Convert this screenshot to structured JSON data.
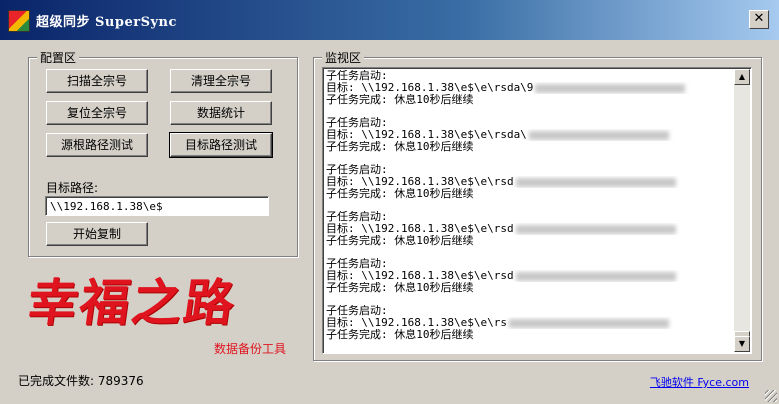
{
  "window": {
    "title": "超级同步 SuperSync",
    "close_glyph": "✕"
  },
  "config": {
    "group_label": "配置区",
    "buttons": {
      "scan": "扫描全宗号",
      "clean": "清理全宗号",
      "reset": "复位全宗号",
      "stats": "数据统计",
      "source_test": "源根路径测试",
      "target_test": "目标路径测试",
      "start_copy": "开始复制"
    },
    "target_path_label": "目标路径:",
    "target_path_value": "\\\\192.168.1.38\\e$"
  },
  "logo": {
    "text": "幸福之路",
    "subtitle": "数据备份工具"
  },
  "monitor": {
    "group_label": "监视区",
    "entries": [
      {
        "line1": "子任务启动:",
        "line2": "目标: \\\\192.168.1.38\\e$\\e\\rsda\\9",
        "line3": "子任务完成: 休息10秒后继续"
      },
      {
        "line1": "子任务启动:",
        "line2": "目标: \\\\192.168.1.38\\e$\\e\\rsda\\",
        "line3": "子任务完成: 休息10秒后继续"
      },
      {
        "line1": "子任务启动:",
        "line2": "目标: \\\\192.168.1.38\\e$\\e\\rsd",
        "line3": "子任务完成: 休息10秒后继续"
      },
      {
        "line1": "子任务启动:",
        "line2": "目标: \\\\192.168.1.38\\e$\\e\\rsd",
        "line3": "子任务完成: 休息10秒后继续"
      },
      {
        "line1": "子任务启动:",
        "line2": "目标: \\\\192.168.1.38\\e$\\e\\rsd",
        "line3": "子任务完成: 休息10秒后继续"
      },
      {
        "line1": "子任务启动:",
        "line2": "目标: \\\\192.168.1.38\\e$\\e\\rs",
        "line3": "子任务完成: 休息10秒后继续"
      }
    ],
    "scroll_up_glyph": "▲",
    "scroll_down_glyph": "▼"
  },
  "status": {
    "completed_label": "已完成文件数:",
    "completed_count": "789376",
    "link_text": "飞驰软件 Fyce.com"
  }
}
